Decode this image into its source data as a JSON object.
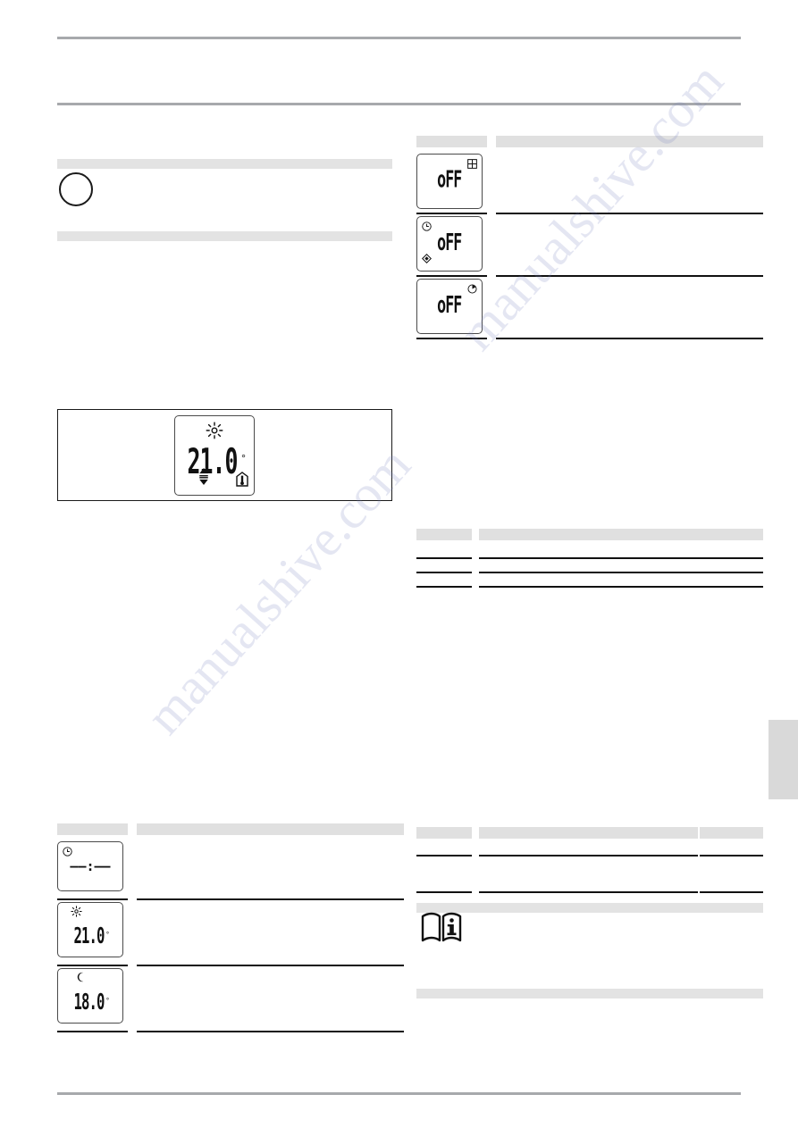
{
  "document": {
    "type": "appliance-manual-page",
    "language_hint": "de",
    "header_rule_color": "#a7a9ac",
    "accent_band_color": "#e3e3e3",
    "ink_color": "#111111"
  },
  "watermark": {
    "line1": "manualshive.com",
    "line2": "manualshive.com"
  },
  "left_column": {
    "note_block": {
      "top_band_label": "",
      "marker_icon": "circle-icon",
      "body_text": "",
      "bottom_band_label": ""
    },
    "figure_panel": {
      "caption": "",
      "display": {
        "mode_icon": "sun-icon",
        "value": "21.0",
        "unit": "°",
        "adjust_icon": "up-down-arrows-icon",
        "sensor_icon": "room-temperature-icon"
      }
    },
    "table": {
      "headers": [
        "",
        ""
      ],
      "rows": [
        {
          "display": {
            "icon_top_left": "clock-icon",
            "value": "––:––",
            "unit": ""
          },
          "description": ""
        },
        {
          "display": {
            "icon_top_left": "sun-icon",
            "value": "21.0",
            "unit": "°"
          },
          "description": ""
        },
        {
          "display": {
            "icon_top_left": "moon-icon",
            "value": "18.0",
            "unit": "°"
          },
          "description": ""
        }
      ]
    }
  },
  "right_column": {
    "table_top": {
      "headers": [
        "",
        ""
      ],
      "rows": [
        {
          "display": {
            "icon_top_right": "window-icon",
            "value": "oFF"
          },
          "description": ""
        },
        {
          "display": {
            "icon_top_left": "clock-icon",
            "icon_bottom_left": "diamond-icon",
            "value": "oFF"
          },
          "description": ""
        },
        {
          "display": {
            "icon_top_right": "timer-icon",
            "value": "oFF"
          },
          "description": ""
        }
      ]
    },
    "table_middle": {
      "headers": [
        "",
        ""
      ],
      "rows": [
        {
          "col1": "",
          "col2": ""
        },
        {
          "col1": "",
          "col2": ""
        },
        {
          "col1": "",
          "col2": ""
        }
      ]
    },
    "table_bottom": {
      "headers": [
        "",
        "",
        ""
      ],
      "rows": [
        {
          "col1": "",
          "col2": "",
          "col3": ""
        },
        {
          "col1": "",
          "col2": "",
          "col3": ""
        }
      ]
    },
    "notice_block": {
      "icon": "read-manual-book-icon",
      "text": ""
    }
  },
  "page_edge_tab": {
    "label": "",
    "color": "#d9d9d9"
  }
}
